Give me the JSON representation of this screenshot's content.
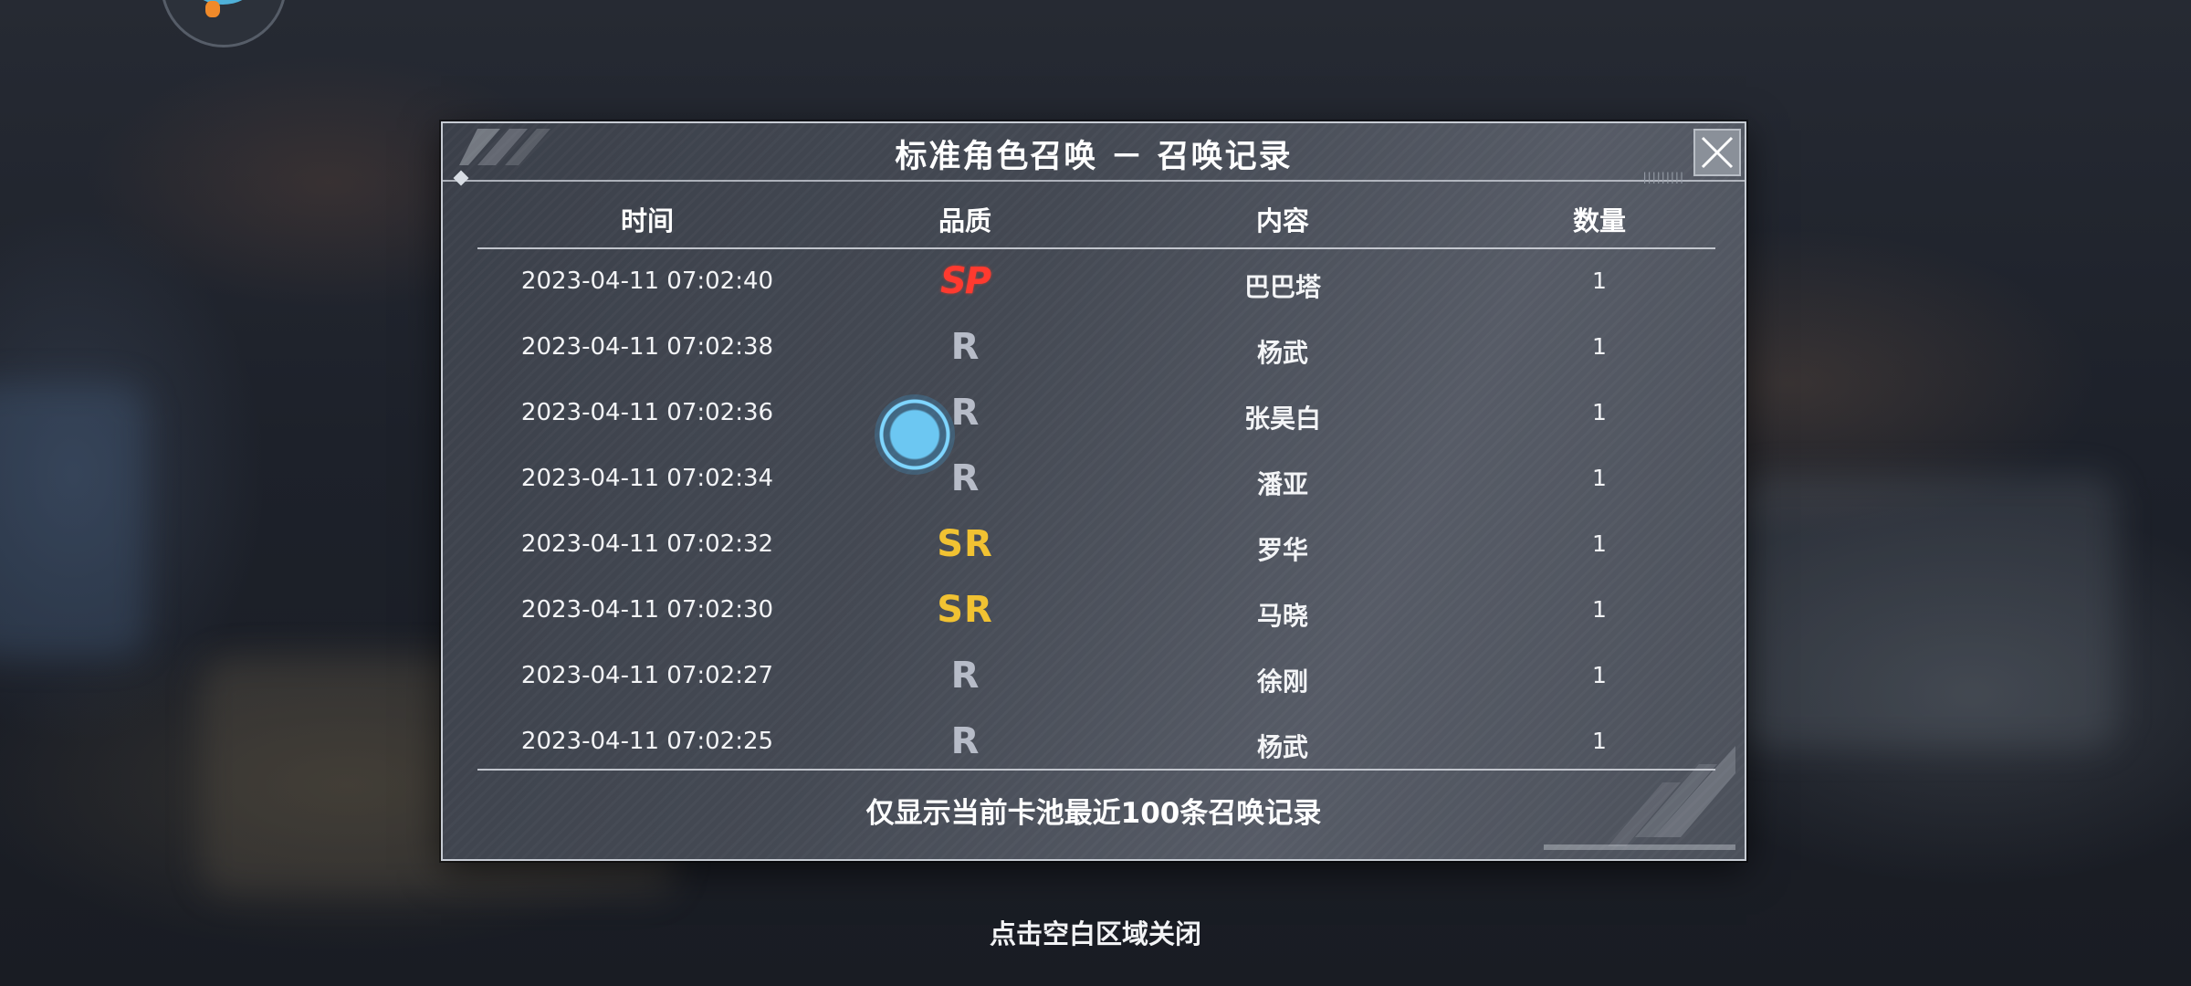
{
  "dialog": {
    "title": "标准角色召唤 － 召唤记录",
    "columns": {
      "time": "时间",
      "quality": "品质",
      "content": "内容",
      "quantity": "数量"
    },
    "rows": [
      {
        "time": "2023-04-11 07:02:40",
        "quality": "SP",
        "content": "巴巴塔",
        "quantity": "1"
      },
      {
        "time": "2023-04-11 07:02:38",
        "quality": "R",
        "content": "杨武",
        "quantity": "1"
      },
      {
        "time": "2023-04-11 07:02:36",
        "quality": "R",
        "content": "张昊白",
        "quantity": "1"
      },
      {
        "time": "2023-04-11 07:02:34",
        "quality": "R",
        "content": "潘亚",
        "quantity": "1"
      },
      {
        "time": "2023-04-11 07:02:32",
        "quality": "SR",
        "content": "罗华",
        "quantity": "1"
      },
      {
        "time": "2023-04-11 07:02:30",
        "quality": "SR",
        "content": "马晓",
        "quantity": "1"
      },
      {
        "time": "2023-04-11 07:02:27",
        "quality": "R",
        "content": "徐刚",
        "quantity": "1"
      },
      {
        "time": "2023-04-11 07:02:25",
        "quality": "R",
        "content": "杨武",
        "quantity": "1"
      }
    ],
    "footer_note": "仅显示当前卡池最近100条召唤记录",
    "close_icon": "close-x-icon"
  },
  "hint": "点击空白区域关闭",
  "colors": {
    "SP": "#ff3a2f",
    "SR": "#f1c232",
    "R": "#b7bcc8"
  }
}
